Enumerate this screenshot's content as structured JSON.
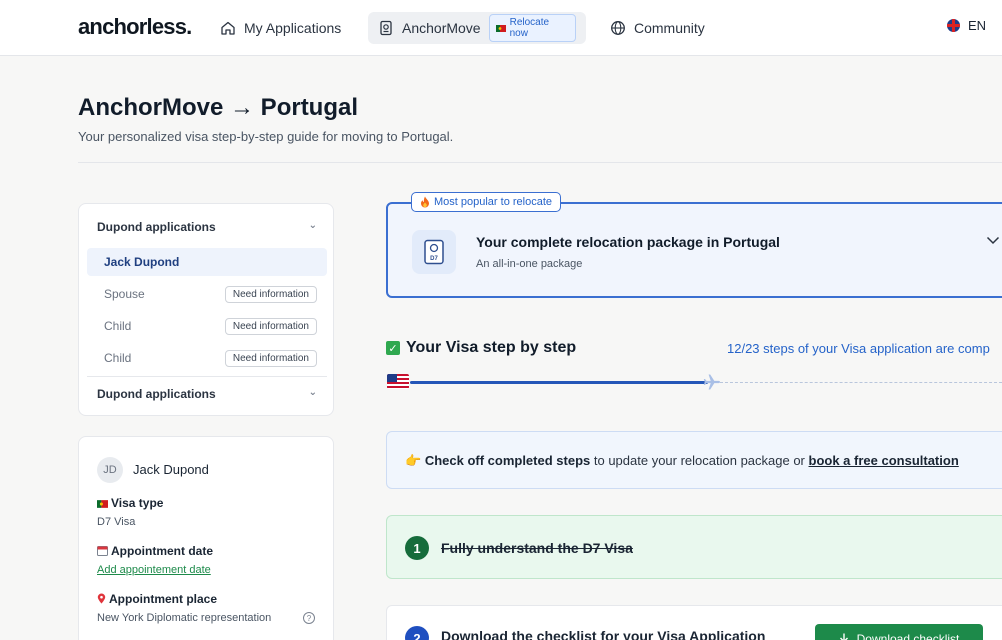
{
  "nav": {
    "logo": "anchorless.",
    "my_applications": "My Applications",
    "anchormove": "AnchorMove",
    "relocate_badge": "Relocate now",
    "community": "Community",
    "language": "EN"
  },
  "header": {
    "title": "AnchorMove → Portugal",
    "subtitle": "Your personalized visa step-by-step guide for moving to Portugal."
  },
  "applications": {
    "group_title": "Dupond applications",
    "members": [
      {
        "name": "Jack Dupond",
        "status": ""
      },
      {
        "name": "Spouse",
        "status": "Need information"
      },
      {
        "name": "Child",
        "status": "Need information"
      },
      {
        "name": "Child",
        "status": "Need information"
      }
    ],
    "second_group_title": "Dupond applications"
  },
  "person": {
    "initials": "JD",
    "name": "Jack Dupond",
    "visa_type_label": "Visa type",
    "visa_type_value": "D7 Visa",
    "appointment_date_label": "Appointment date",
    "appointment_date_link": "Add appointement date",
    "appointment_place_label": "Appointment place",
    "appointment_place_value": "New York Diplomatic representation"
  },
  "package": {
    "tag": "Most popular to relocate",
    "title": "Your complete relocation package in Portugal",
    "subtitle": "An all-in-one package",
    "icon_label": "D7"
  },
  "progress": {
    "title": "Your Visa step by step",
    "count_text": "12/23 steps of your Visa application are comp",
    "completed": 12,
    "total": 23
  },
  "info": {
    "bold_text": "Check off completed steps",
    "middle_text": " to update your relocation package or ",
    "link_text": "book a free consultation"
  },
  "steps": [
    {
      "number": "1",
      "title": "Fully understand the D7 Visa",
      "done": true
    },
    {
      "number": "2",
      "title": "Download the checklist for your Visa Application",
      "done": false,
      "button": "Download checklist"
    }
  ],
  "colors": {
    "accent_blue": "#2563c9",
    "success_green": "#1d8a4a",
    "done_bg": "#e9f8ee"
  }
}
